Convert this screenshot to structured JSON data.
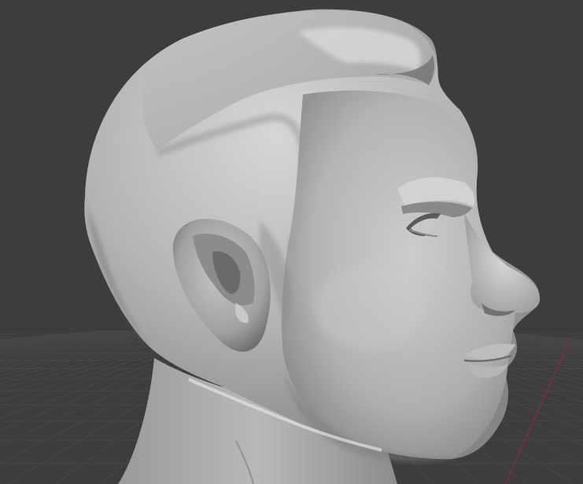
{
  "viewport": {
    "background_color": "#3d3d3d",
    "grid_line_color": "#474747",
    "x_axis_color": "#8a2e3a",
    "model_base_color": "#a8a8a8",
    "model_highlight_color": "#dcdcdc",
    "model_shadow_color": "#5c5c5c",
    "shading_mode": "solid",
    "grid_floor": true,
    "x_axis_visible": true
  },
  "model": {
    "subject": "sculpted-male-head-bust",
    "view": "three-quarter-right-profile"
  }
}
